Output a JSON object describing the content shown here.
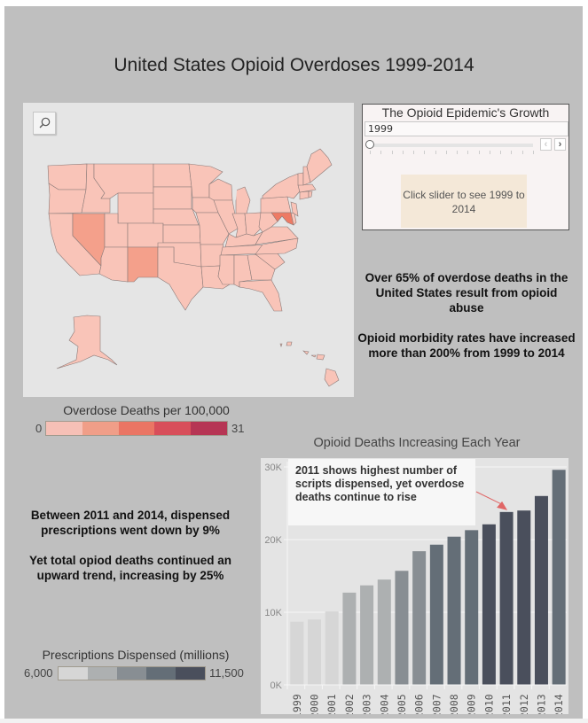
{
  "title": "United States Opioid Overdoses 1999-2014",
  "map": {
    "zoom_button_icon": "search-icon",
    "default_fill": "#f9c4b8",
    "highlight_states": {
      "Nevada": "#f4a08b",
      "New Mexico": "#f4a08b",
      "Maryland": "#ee7a64"
    },
    "border_color": "#8a7a78",
    "background": "#e5e5e5"
  },
  "map_legend": {
    "title": "Overdose Deaths per 100,000",
    "min": "0",
    "max": "31",
    "colors": [
      "#f6c0b6",
      "#f09e88",
      "#ea7564",
      "#d84e5a",
      "#b63554"
    ]
  },
  "slider": {
    "title": "The Opioid Epidemic's Growth",
    "value": "1999",
    "min_year": 1999,
    "max_year": 2014,
    "position_fraction": 0,
    "prev_icon": "chevron-left-icon",
    "next_icon": "chevron-right-icon",
    "hint": "Click slider to see 1999 to 2014"
  },
  "facts": {
    "fact1": "Over 65% of overdose deaths in the United States result from opioid abuse",
    "fact2": "Opioid morbidity rates have increased more than 200% from 1999 to 2014",
    "fact3": "Between 2011 and 2014, dispensed prescriptions went down by 9%",
    "fact4": "Yet total opiod deaths continued an upward trend, increasing by 25%"
  },
  "prescriptions_legend": {
    "title": "Prescriptions Dispensed (millions)",
    "min": "6,000",
    "max": "11,500",
    "colors": [
      "#d6d6d6",
      "#adb0b1",
      "#888e93",
      "#646e77",
      "#4a4f5c"
    ]
  },
  "chart_data": {
    "type": "bar",
    "title": "Opioid Deaths Increasing Each Year",
    "xlabel": "",
    "ylabel": "",
    "ylim": [
      0,
      30500
    ],
    "yticks": [
      0,
      10000,
      20000,
      30000
    ],
    "ytick_labels": [
      "0K",
      "10K",
      "20K",
      "30K"
    ],
    "grid": true,
    "categories": [
      "1999",
      "2000",
      "2001",
      "2002",
      "2003",
      "2004",
      "2005",
      "2006",
      "2007",
      "2008",
      "2009",
      "2010",
      "2011",
      "2012",
      "2013",
      "2014"
    ],
    "values": [
      8700,
      9000,
      10100,
      12700,
      13700,
      14500,
      15700,
      18400,
      19300,
      20400,
      21300,
      22100,
      23800,
      24000,
      26000,
      29600
    ],
    "color_bucket": [
      0,
      0,
      0,
      1,
      1,
      1,
      2,
      2,
      3,
      3,
      3,
      4,
      4,
      4,
      4,
      3
    ],
    "annotation": {
      "text": "2011 shows highest number of scripts dispensed, yet overdose deaths continue to rise",
      "target_category": "2011",
      "arrow_color": "#e06666"
    }
  }
}
